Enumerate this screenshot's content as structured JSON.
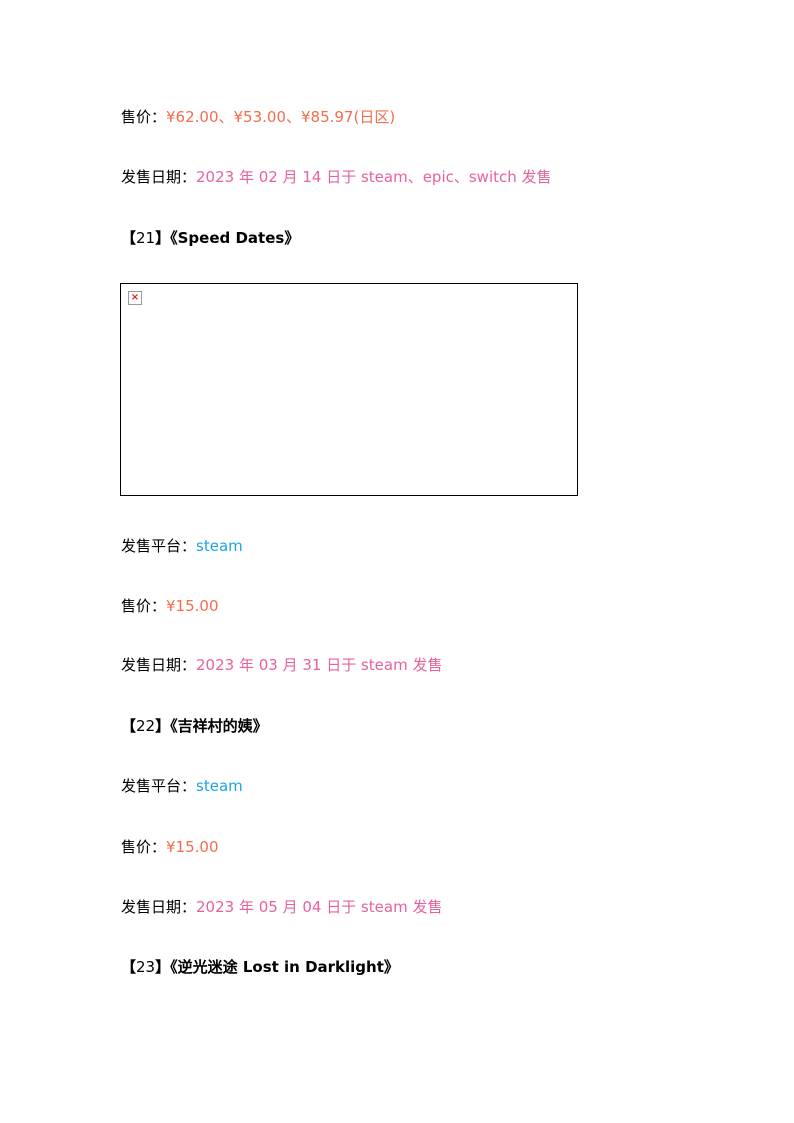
{
  "entry20": {
    "price_label": "售价：",
    "price_value": "¥62.00、¥53.00、¥85.97(日区)",
    "date_label": "发售日期：",
    "date_value": "2023 年 02 月 14 日于 steam、epic、switch 发售"
  },
  "entry21": {
    "heading_open": "【",
    "heading_num": "21",
    "heading_close": "】",
    "title": "《Speed Dates》",
    "image": {
      "icon": "broken-image-icon",
      "glyph": "×"
    },
    "platform_label": "发售平台：",
    "platform_value": "steam",
    "price_label": "售价：",
    "price_value": "¥15.00",
    "date_label": "发售日期：",
    "date_value": "2023 年 03 月 31 日于 steam 发售"
  },
  "entry22": {
    "heading_open": "【",
    "heading_num": "22",
    "heading_close": "】",
    "title": "《吉祥村的姨》",
    "platform_label": "发售平台：",
    "platform_value": "steam",
    "price_label": "售价：",
    "price_value": "¥15.00",
    "date_label": "发售日期：",
    "date_value": "2023 年 05 月 04 日于 steam 发售"
  },
  "entry23": {
    "heading_open": "【",
    "heading_num": "23",
    "heading_close": "】",
    "title": "《逆光迷途  Lost in Darklight》"
  },
  "colors": {
    "price": "#f26d4d",
    "date": "#e8609f",
    "platform": "#1aa3e8",
    "text": "#000000"
  }
}
